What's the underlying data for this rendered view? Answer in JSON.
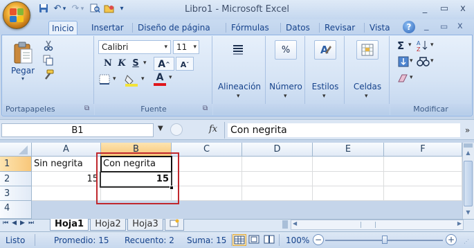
{
  "window": {
    "title": "Libro1 - Microsoft Excel",
    "min": "_",
    "restore": "▭",
    "close": "x"
  },
  "qat": {
    "undo": "↶",
    "redo": "↷",
    "dropdown": "▾"
  },
  "tabs": [
    {
      "label": "Inicio"
    },
    {
      "label": "Insertar"
    },
    {
      "label": "Diseño de página"
    },
    {
      "label": "Fórmulas"
    },
    {
      "label": "Datos"
    },
    {
      "label": "Revisar"
    },
    {
      "label": "Vista"
    }
  ],
  "ribbon_ctrl": {
    "help": "?",
    "min": "_",
    "restore": "▭",
    "close": "x"
  },
  "clipboard": {
    "paste": "Pegar",
    "label": "Portapapeles",
    "launcher": "⧉"
  },
  "font": {
    "name": "Calibri",
    "size": "11",
    "bold": "N",
    "italic": "K",
    "underline": "S",
    "grow": "A",
    "shrink": "A",
    "fill_color": "#f3e338",
    "font_color": "#e0161c",
    "label": "Fuente"
  },
  "groups": {
    "alignment": "Alineación",
    "number": "Número",
    "styles": "Estilos",
    "cells": "Celdas",
    "editing_label": "Modificar",
    "sigma": "Σ"
  },
  "formula_bar": {
    "name_box": "B1",
    "fx": "fx",
    "value": "Con negrita",
    "expand": "»"
  },
  "grid": {
    "columns": [
      "A",
      "B",
      "C",
      "D",
      "E",
      "F"
    ],
    "rows": [
      "1",
      "2",
      "3",
      "4"
    ],
    "cells": {
      "A1": "Sin negrita",
      "B1": "Con negrita",
      "A2": "15",
      "B2": "15"
    }
  },
  "sheets": [
    "Hoja1",
    "Hoja2",
    "Hoja3"
  ],
  "status": {
    "mode": "Listo",
    "average": "Promedio: 15",
    "count": "Recuento: 2",
    "sum": "Suma: 15",
    "zoom": "100%",
    "zoom_out": "−",
    "zoom_in": "+"
  },
  "colors": {
    "accent_blue": "#15428b",
    "selection_orange": "#f8c77a",
    "highlight_red": "#c0272d"
  }
}
